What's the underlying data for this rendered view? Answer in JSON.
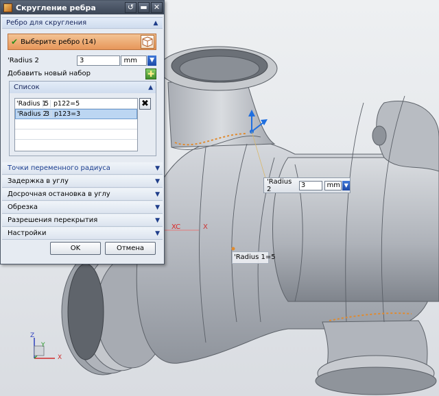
{
  "window": {
    "title": "Скругление ребра",
    "buttons": {
      "reset": "↺",
      "min": "▬",
      "close": "✕"
    }
  },
  "edge_group": {
    "header": "Ребро для скругления",
    "select_label": "Выберите ребро (14)",
    "radius_label": "'Radius 2",
    "radius_value": "3",
    "radius_unit": "mm",
    "add_set_label": "Добавить новый набор"
  },
  "list_group": {
    "header": "Список",
    "rows": [
      {
        "name": "'Radius 1",
        "value": "5",
        "expr": "p122=5",
        "selected": false
      },
      {
        "name": "'Radius 2",
        "value": "3",
        "expr": "p123=3",
        "selected": true
      }
    ]
  },
  "sections": [
    {
      "label": "Точки переменного радиуса",
      "highlight": true
    },
    {
      "label": "Задержка в углу",
      "highlight": false
    },
    {
      "label": "Досрочная остановка в углу",
      "highlight": false
    },
    {
      "label": "Обрезка",
      "highlight": false
    },
    {
      "label": "Разрешения перекрытия",
      "highlight": false
    },
    {
      "label": "Настройки",
      "highlight": false
    }
  ],
  "footer": {
    "ok": "OK",
    "cancel": "Отмена"
  },
  "viewport": {
    "radius2_callout": {
      "label": "'Radius 2",
      "value": "3",
      "unit": "mm"
    },
    "radius1_label": "'Radius 1=5",
    "csys_label": "XC",
    "x_label": "X",
    "triad": {
      "z": "Z",
      "y": "Y",
      "x": "X"
    }
  },
  "colors": {
    "title_bar": "#4a5566",
    "select_row": "#eba872",
    "accent_blue": "#1d4aa8",
    "model_gray": "#b8bcc3",
    "edge_orange": "#e08a2e"
  }
}
